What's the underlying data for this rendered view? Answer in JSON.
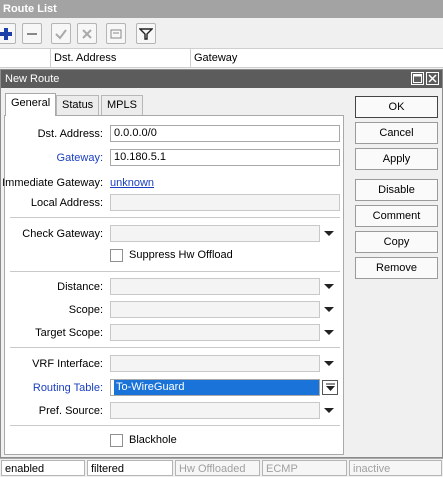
{
  "route_list": {
    "title": "Route List",
    "toolbar_icons": [
      "plus-icon",
      "minus-icon",
      "check-icon",
      "x-icon",
      "comment-icon",
      "filter-icon"
    ],
    "columns": [
      "Dst. Address",
      "Gateway"
    ]
  },
  "dialog": {
    "title": "New Route",
    "tabs": [
      "General",
      "Status",
      "MPLS"
    ],
    "active_tab": "General",
    "fields": {
      "dst_address": {
        "label": "Dst. Address:",
        "value": "0.0.0.0/0"
      },
      "gateway": {
        "label": "Gateway:",
        "value": "10.180.5.1"
      },
      "immediate_gateway": {
        "label": "Immediate Gateway:",
        "value": "unknown"
      },
      "local_address": {
        "label": "Local Address:",
        "value": ""
      },
      "check_gateway": {
        "label": "Check Gateway:",
        "value": ""
      },
      "suppress_hw_offload": {
        "label": "Suppress Hw Offload",
        "checked": false
      },
      "distance": {
        "label": "Distance:",
        "value": ""
      },
      "scope": {
        "label": "Scope:",
        "value": ""
      },
      "target_scope": {
        "label": "Target Scope:",
        "value": ""
      },
      "vrf_interface": {
        "label": "VRF Interface:",
        "value": ""
      },
      "routing_table": {
        "label": "Routing Table:",
        "value": "To-WireGuard"
      },
      "pref_source": {
        "label": "Pref. Source:",
        "value": ""
      },
      "blackhole": {
        "label": "Blackhole",
        "checked": false
      }
    },
    "buttons": {
      "ok": "OK",
      "cancel": "Cancel",
      "apply": "Apply",
      "disable": "Disable",
      "comment": "Comment",
      "copy": "Copy",
      "remove": "Remove"
    }
  },
  "status_bar": [
    "enabled",
    "filtered",
    "Hw Offloaded",
    "ECMP",
    "inactive"
  ],
  "colors": {
    "link": "#1a3fc0",
    "selection": "#1a73d9",
    "title_bar": "#5c5c5c"
  }
}
